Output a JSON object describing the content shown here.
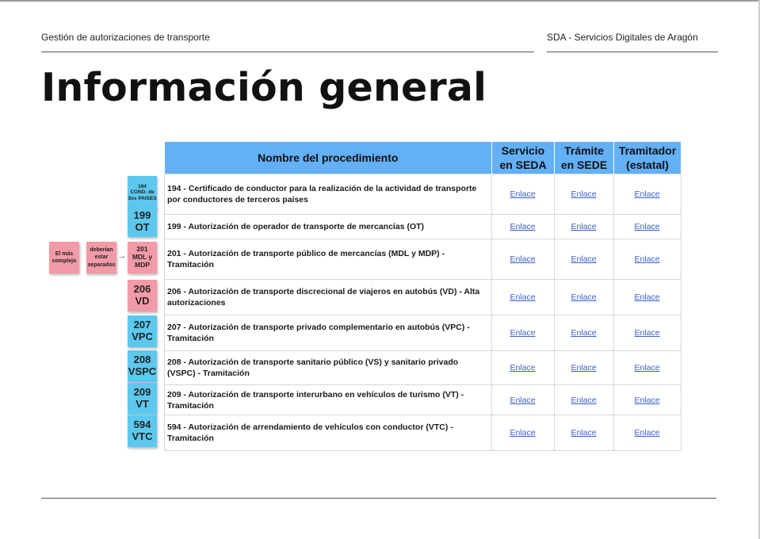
{
  "header": {
    "left": "Gestión de autorizaciones de transporte",
    "right": "SDA - Servicios Digitales de Aragón"
  },
  "page_title": "Información general",
  "table": {
    "headers": [
      "Nombre del procedimiento",
      "Servicio en SEDA",
      "Trámite en SEDE",
      "Tramitador (estatal)"
    ],
    "rows": [
      {
        "name": "194 - Certificado de conductor para la realización de la actividad de transporte por conductores de terceros países",
        "links": [
          "Enlace",
          "Enlace",
          "Enlace"
        ]
      },
      {
        "name": "199 - Autorización de operador de transporte de mercancías (OT)",
        "links": [
          "Enlace",
          "Enlace",
          "Enlace"
        ]
      },
      {
        "name": "201 - Autorización de transporte público de mercancías (MDL y MDP) - Tramitación",
        "links": [
          "Enlace",
          "Enlace",
          "Enlace"
        ]
      },
      {
        "name": "206 - Autorización de transporte discrecional de viajeros en autobús (VD) - Alta autorizaciones",
        "links": [
          "Enlace",
          "Enlace",
          "Enlace"
        ]
      },
      {
        "name": "207 - Autorización de transporte privado complementario en autobús (VPC) - Tramitación",
        "links": [
          "Enlace",
          "Enlace",
          "Enlace"
        ]
      },
      {
        "name": "208 - Autorización de transporte sanitario público (VS) y sanitario privado (VSPC) - Tramitación",
        "links": [
          "Enlace",
          "Enlace",
          "Enlace"
        ]
      },
      {
        "name": "209 - Autorización de transporte interurbano en vehículos de turismo (VT) - Tramitación",
        "links": [
          "Enlace",
          "Enlace",
          "Enlace"
        ]
      },
      {
        "name": "594 - Autorización de arrendamiento de vehículos con conductor (VTC) - Tramitación",
        "links": [
          "Enlace",
          "Enlace",
          "Enlace"
        ]
      }
    ]
  },
  "stickies": [
    {
      "line1": "194",
      "line2": "COND. de",
      "line3": "3os PAISES",
      "color": "#5cc8ee"
    },
    {
      "line1": "199",
      "line2": "OT",
      "color": "#5cc8ee"
    },
    {
      "line1": "201",
      "line2": "MDL y",
      "line3": "MDP",
      "color": "#f29aa8"
    },
    {
      "line1": "206",
      "line2": "VD",
      "color": "#f29aa8"
    },
    {
      "line1": "207",
      "line2": "VPC",
      "color": "#5cc8ee"
    },
    {
      "line1": "208",
      "line2": "VSPC",
      "color": "#5cc8ee"
    },
    {
      "line1": "209",
      "line2": "VT",
      "color": "#5cc8ee"
    },
    {
      "line1": "594",
      "line2": "VTC",
      "color": "#5cc8ee"
    }
  ],
  "notes": {
    "mas_complejo": "El más complejo",
    "separados": "deberían estar separados",
    "arrow": "→"
  },
  "colors": {
    "header_blue": "#63b0f7",
    "sticky_blue": "#5cc8ee",
    "sticky_pink": "#f29aa8",
    "link": "#3a5fc7"
  }
}
